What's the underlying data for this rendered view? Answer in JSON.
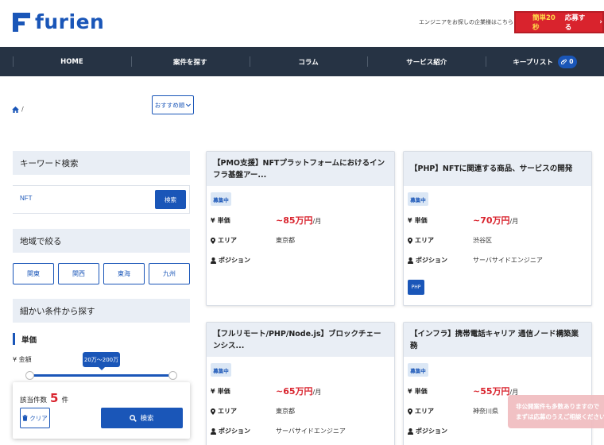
{
  "header": {
    "logo_text": "furien",
    "company_link": "エンジニアをお探しの企業様はこちら",
    "apply_highlight": "簡単20秒",
    "apply_label": "応募する",
    "apply_chevron": "›",
    "brand_color": "#1a56b8",
    "accent_color": "#d9232d"
  },
  "nav": {
    "items": [
      {
        "label": "HOME"
      },
      {
        "label": "案件を探す"
      },
      {
        "label": "コラム"
      },
      {
        "label": "サービス紹介"
      },
      {
        "label": "キープリスト",
        "badge": "0"
      }
    ],
    "bg_color": "#263344"
  },
  "breadcrumb": {
    "separator": "/",
    "icon": "home-icon"
  },
  "sort": {
    "label": "おすすめ順"
  },
  "sidebar": {
    "keyword": {
      "title": "キーワード検索",
      "value": "NFT",
      "button": "検索"
    },
    "region": {
      "title": "地域で絞る",
      "options": [
        "関東",
        "関西",
        "東海",
        "九州"
      ]
    },
    "detail": {
      "title": "細かい条件から探す",
      "price_label": "単価",
      "price_field": "¥ 金額",
      "range_label": "20万～200万"
    },
    "result": {
      "prefix": "該当件数",
      "count": "5",
      "suffix": "件",
      "clear": "クリア",
      "search": "検索"
    }
  },
  "jobs": [
    {
      "title": "【PMO支援】NFTプラットフォームにおけるインフラ基盤アー...",
      "status": "募集中",
      "price_label": "単価",
      "price": "~85万円",
      "unit": "/月",
      "area_label": "エリア",
      "area": "東京都",
      "position_label": "ポジション",
      "position": ""
    },
    {
      "title": "【PHP】NFTに関連する商品、サービスの開発",
      "status": "募集中",
      "price_label": "単価",
      "price": "~70万円",
      "unit": "/月",
      "area_label": "エリア",
      "area": "渋谷区",
      "position_label": "ポジション",
      "position": "サーバサイドエンジニア",
      "tag": "PHP"
    },
    {
      "title": "【フルリモート/PHP/Node.js】ブロックチェーンシス...",
      "status": "募集中",
      "price_label": "単価",
      "price": "~65万円",
      "unit": "/月",
      "area_label": "エリア",
      "area": "東京都",
      "position_label": "ポジション",
      "position": "サーバサイドエンジニア"
    },
    {
      "title": "【インフラ】携帯電話キャリア 通信ノード構築業務",
      "status": "募集中",
      "price_label": "単価",
      "price": "~55万円",
      "unit": "/月",
      "area_label": "エリア",
      "area": "神奈川県",
      "position_label": "ポジション",
      "position": ""
    }
  ],
  "toast": {
    "line1": "非公開案件も多数ありますので",
    "line2": "まずは応募のうえご相談ください"
  }
}
